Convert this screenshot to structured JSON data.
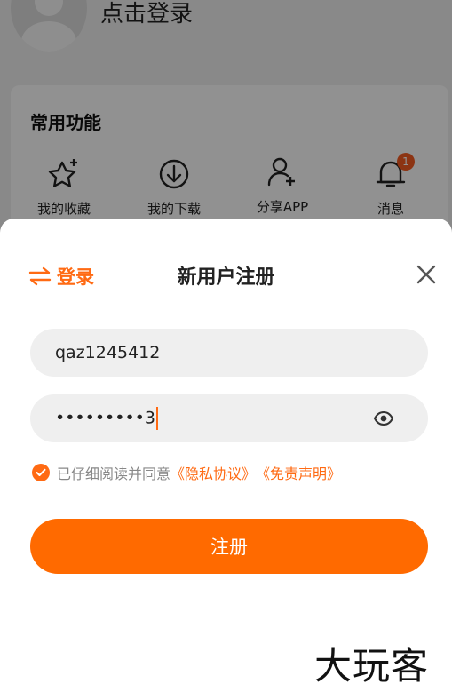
{
  "background": {
    "login_prompt": "点击登录",
    "section_title": "常用功能",
    "functions": [
      {
        "label": "我的收藏",
        "icon": "star-icon"
      },
      {
        "label": "我的下载",
        "icon": "download-icon"
      },
      {
        "label": "分享APP",
        "icon": "add-user-icon"
      },
      {
        "label": "消息",
        "icon": "bell-icon",
        "badge": "1"
      }
    ]
  },
  "sheet": {
    "switch_label": "登录",
    "title": "新用户注册",
    "username_value": "qaz1245412",
    "password_masked": "•••••••••",
    "password_last_char": "3",
    "agree_text": "已仔细阅读并同意",
    "privacy_link": "《隐私协议》",
    "disclaimer_link": "《免责声明》",
    "submit_label": "注册"
  },
  "watermark": "大玩客",
  "colors": {
    "accent": "#ff6a13",
    "button": "#ff6a00",
    "field_bg": "#efefef"
  }
}
